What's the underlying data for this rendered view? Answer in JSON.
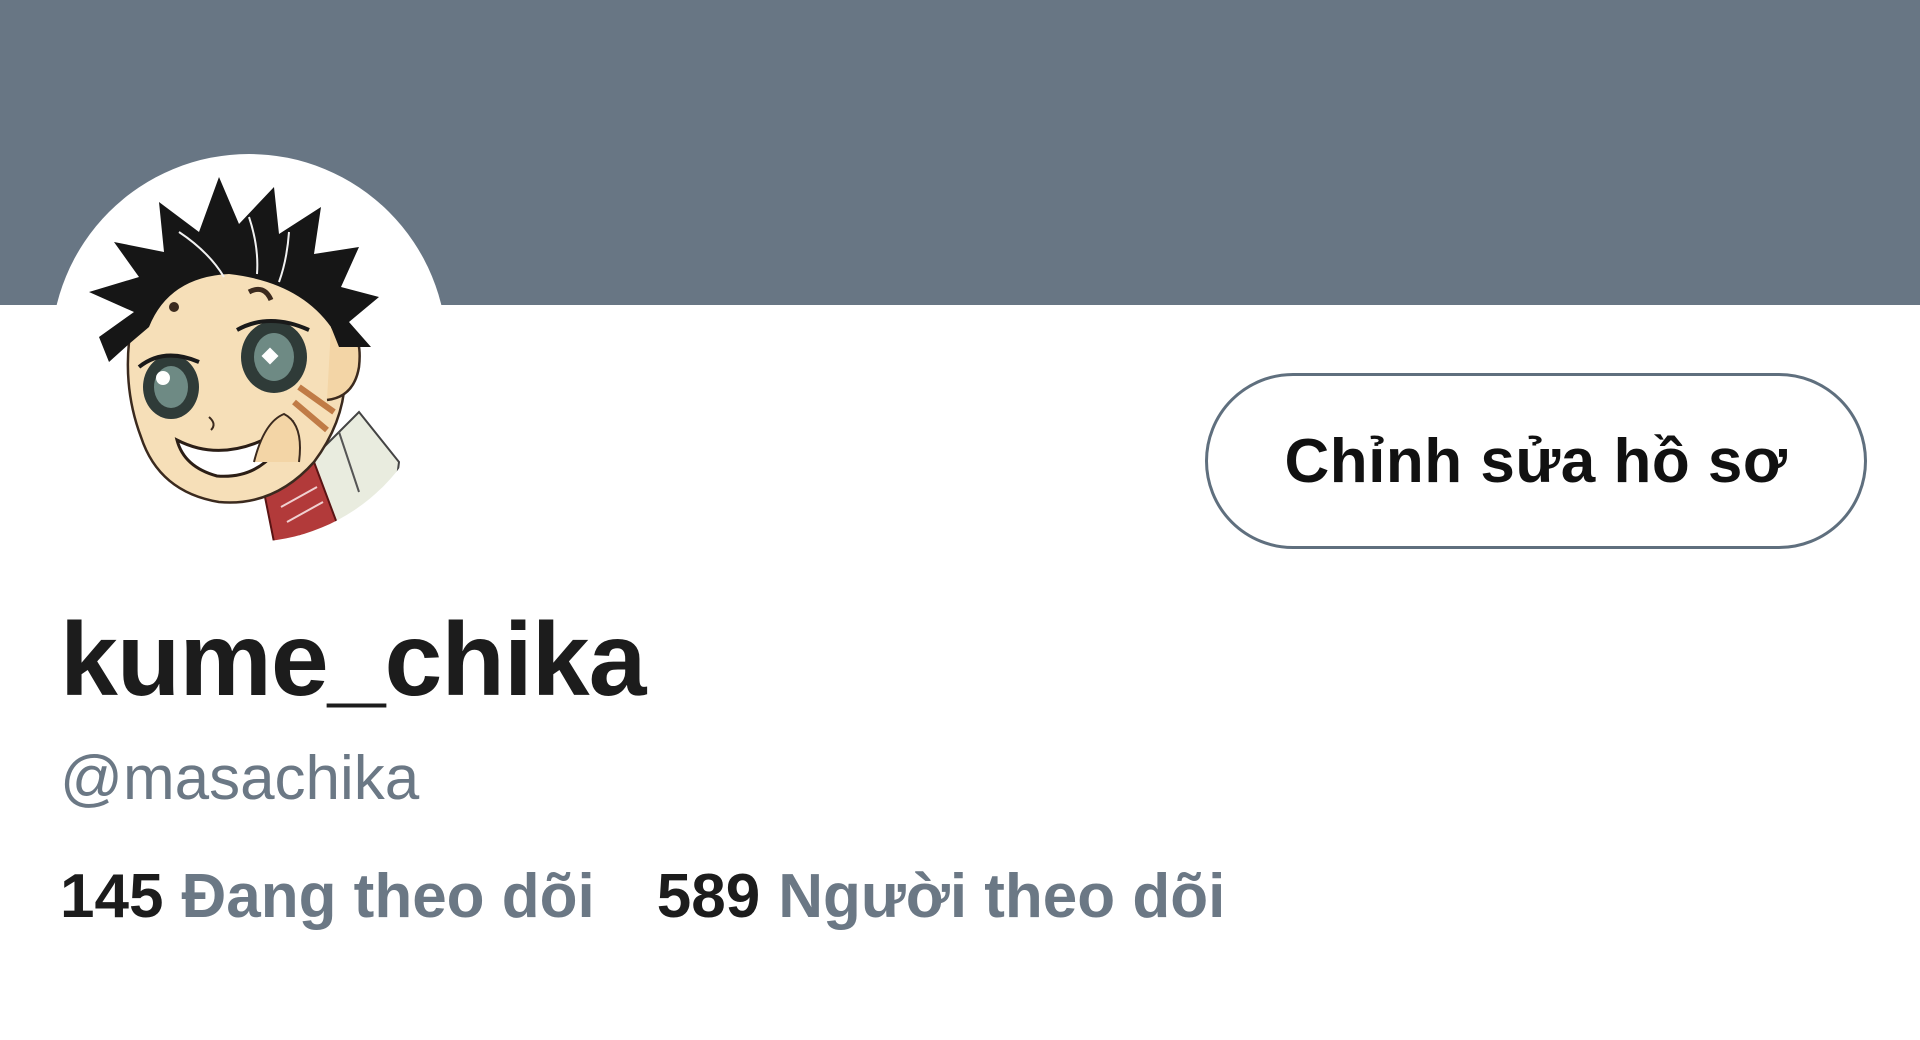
{
  "profile": {
    "display_name": "kume_chika",
    "handle": "@masachika",
    "edit_button_label": "Chỉnh sửa hồ sơ",
    "following_count": "145",
    "following_label": "Đang theo dõi",
    "followers_count": "589",
    "followers_label": "Người theo dõi"
  },
  "colors": {
    "banner": "#687684",
    "primary_text": "#1c1c1c",
    "secondary_text": "#6b7885",
    "button_border": "#5f6f7e"
  }
}
